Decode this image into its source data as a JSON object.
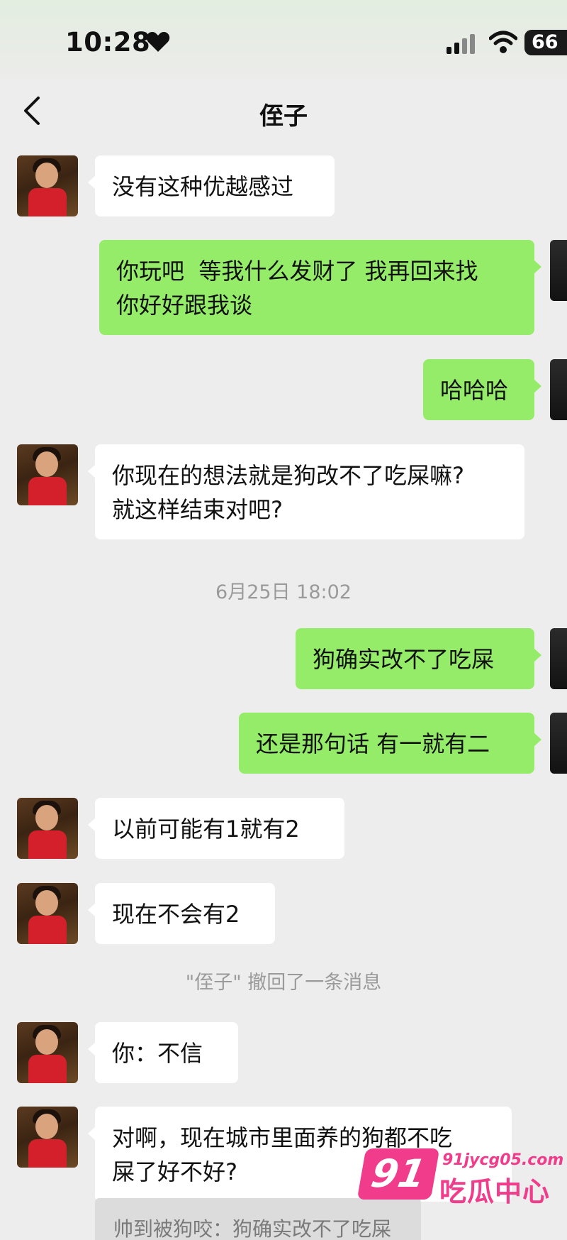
{
  "status_bar": {
    "time": "10:28",
    "battery": "66"
  },
  "header": {
    "title": "侄子"
  },
  "messages": [
    {
      "side": "in",
      "text": "没有这种优越感过"
    },
    {
      "side": "out",
      "text": "你玩吧  等我什么发财了 我再回来找\n你好好跟我谈"
    },
    {
      "side": "out",
      "text": "哈哈哈"
    },
    {
      "side": "in",
      "text": "你现在的想法就是狗改不了吃屎嘛?\n就这样结束对吧?"
    },
    {
      "side": "out",
      "text": "狗确实改不了吃屎"
    },
    {
      "side": "out",
      "text": "还是那句话 有一就有二"
    },
    {
      "side": "in",
      "text": "以前可能有1就有2"
    },
    {
      "side": "in",
      "text": "现在不会有2"
    },
    {
      "side": "in",
      "text": "你：不信"
    },
    {
      "side": "in",
      "text": "对啊，现在城市里面养的狗都不吃\n屎了好不好?"
    }
  ],
  "system": {
    "timestamp": "6月25日 18:02",
    "recall_notice": "\"侄子\" 撤回了一条消息"
  },
  "quote_text": "帅到被狗咬：狗确实改不了吃屎",
  "watermark": {
    "logo": "91",
    "url": "91jycg05.com",
    "name": "吃瓜中心"
  }
}
